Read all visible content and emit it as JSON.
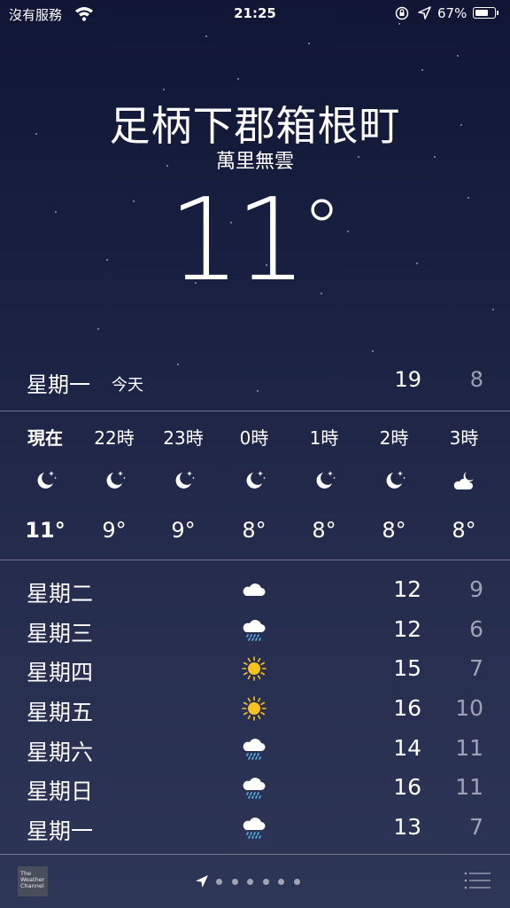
{
  "status": {
    "carrier": "沒有服務",
    "time": "21:25",
    "battery_pct": "67%"
  },
  "location": {
    "city": "足柄下郡箱根町",
    "condition": "萬里無雲",
    "temp": "11"
  },
  "today": {
    "day": "星期一",
    "tag": "今天",
    "high": "19",
    "low": "8"
  },
  "hourly": [
    {
      "time": "現在",
      "icon": "moon-stars-icon",
      "temp": "11°"
    },
    {
      "time": "22時",
      "icon": "moon-stars-icon",
      "temp": "9°"
    },
    {
      "time": "23時",
      "icon": "moon-stars-icon",
      "temp": "9°"
    },
    {
      "time": "0時",
      "icon": "moon-stars-icon",
      "temp": "8°"
    },
    {
      "time": "1時",
      "icon": "moon-stars-icon",
      "temp": "8°"
    },
    {
      "time": "2時",
      "icon": "moon-stars-icon",
      "temp": "8°"
    },
    {
      "time": "3時",
      "icon": "partly-cloudy-night-icon",
      "temp": "8°"
    }
  ],
  "daily": [
    {
      "day": "星期二",
      "icon": "cloud-icon",
      "high": "12",
      "low": "9"
    },
    {
      "day": "星期三",
      "icon": "rain-icon",
      "high": "12",
      "low": "6"
    },
    {
      "day": "星期四",
      "icon": "sun-icon",
      "high": "15",
      "low": "7"
    },
    {
      "day": "星期五",
      "icon": "sun-icon",
      "high": "16",
      "low": "10"
    },
    {
      "day": "星期六",
      "icon": "rain-icon",
      "high": "14",
      "low": "11"
    },
    {
      "day": "星期日",
      "icon": "rain-icon",
      "high": "16",
      "low": "11"
    },
    {
      "day": "星期一",
      "icon": "rain-icon",
      "high": "13",
      "low": "7"
    }
  ],
  "footer": {
    "logo_text": "The Weather Channel",
    "page_count": 6,
    "current_page": 0
  },
  "colors": {
    "sun": "#f5c31d",
    "rain": "#52b6f2",
    "bg_top": "#101634",
    "bg_bottom": "#2e3658"
  }
}
